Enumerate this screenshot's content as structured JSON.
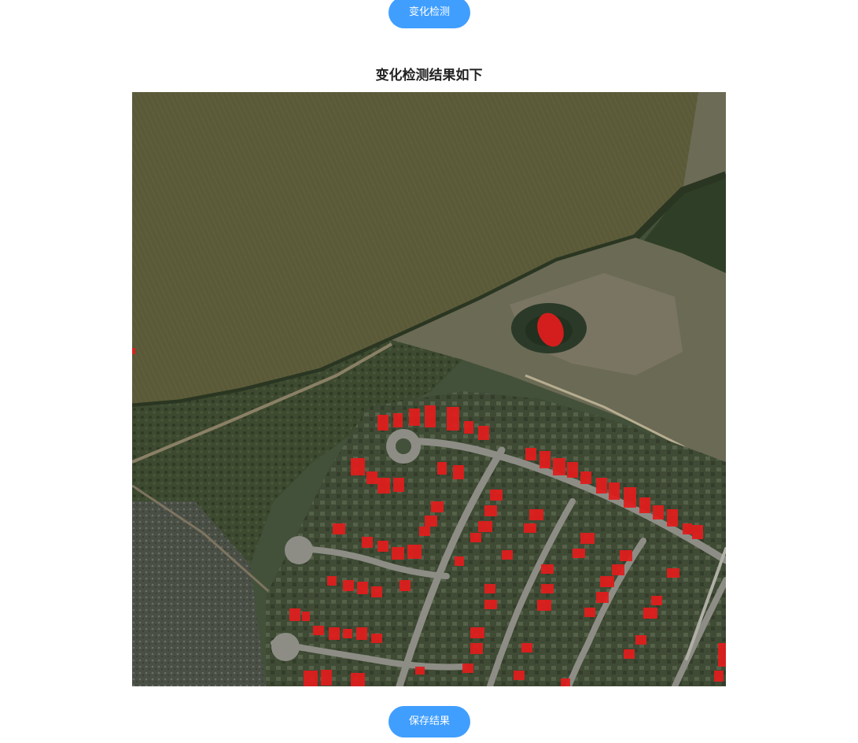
{
  "toolbar": {
    "detect_label": "变化检测"
  },
  "result": {
    "title": "变化检测结果如下",
    "image_icon": "satellite-change-map",
    "highlight_color": "#e21d1d"
  },
  "footer": {
    "save_label": "保存结果"
  }
}
